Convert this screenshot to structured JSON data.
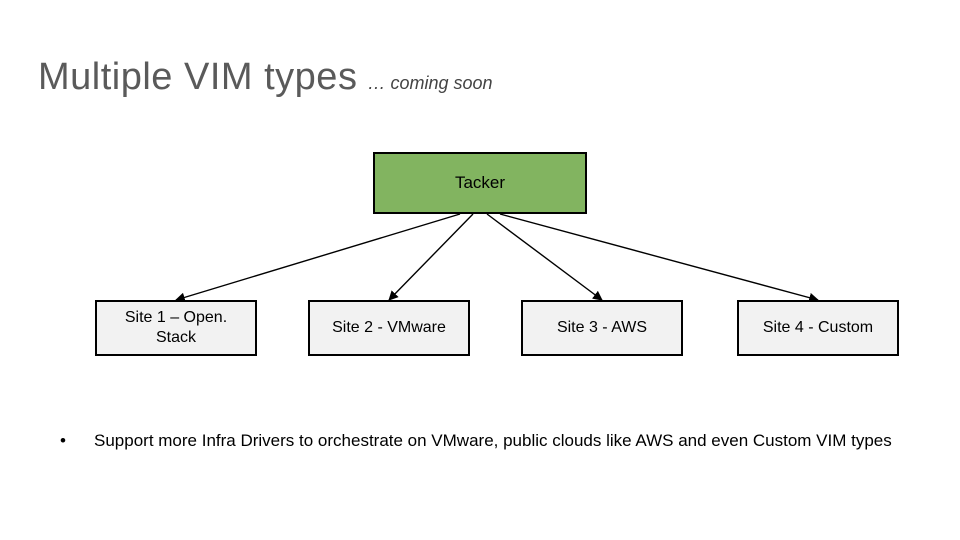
{
  "title": "Multiple VIM types",
  "subtitle": "… coming soon",
  "center_node": {
    "label": "Tacker"
  },
  "sites": [
    {
      "label": "Site 1 – Open. Stack"
    },
    {
      "label": "Site 2 - VMware"
    },
    {
      "label": "Site 3 - AWS"
    },
    {
      "label": "Site 4 - Custom"
    }
  ],
  "bullets": [
    "Support more Infra Drivers to orchestrate on VMware, public clouds like AWS and even Custom VIM types"
  ],
  "bullet_char": "•"
}
